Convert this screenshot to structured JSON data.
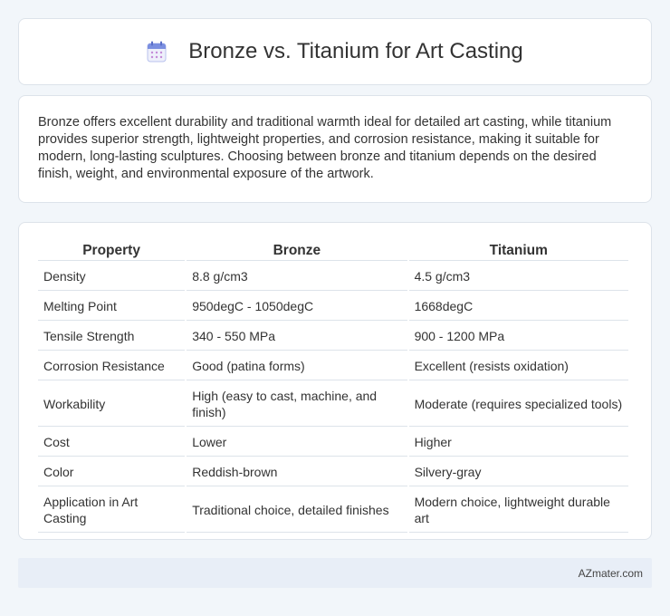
{
  "header": {
    "icon": "calendar-icon",
    "title": "Bronze vs. Titanium for Art Casting"
  },
  "intro": {
    "text": "Bronze offers excellent durability and traditional warmth ideal for detailed art casting, while titanium provides superior strength, lightweight properties, and corrosion resistance, making it suitable for modern, long-lasting sculptures. Choosing between bronze and titanium depends on the desired finish, weight, and environmental exposure of the artwork."
  },
  "table": {
    "headers": [
      "Property",
      "Bronze",
      "Titanium"
    ],
    "rows": [
      [
        "Density",
        "8.8 g/cm3",
        "4.5 g/cm3"
      ],
      [
        "Melting Point",
        "950degC - 1050degC",
        "1668degC"
      ],
      [
        "Tensile Strength",
        "340 - 550 MPa",
        "900 - 1200 MPa"
      ],
      [
        "Corrosion Resistance",
        "Good (patina forms)",
        "Excellent (resists oxidation)"
      ],
      [
        "Workability",
        "High (easy to cast, machine, and finish)",
        "Moderate (requires specialized tools)"
      ],
      [
        "Cost",
        "Lower",
        "Higher"
      ],
      [
        "Color",
        "Reddish-brown",
        "Silvery-gray"
      ],
      [
        "Application in Art Casting",
        "Traditional choice, detailed finishes",
        "Modern choice, lightweight durable art"
      ]
    ]
  },
  "footer": {
    "text": "AZmater.com"
  },
  "colors": {
    "background": "#f2f6fa",
    "card": "#ffffff",
    "border": "#dde3ea",
    "footer_bg": "#e8eef7",
    "icon_accent": "#7b8fe0"
  }
}
